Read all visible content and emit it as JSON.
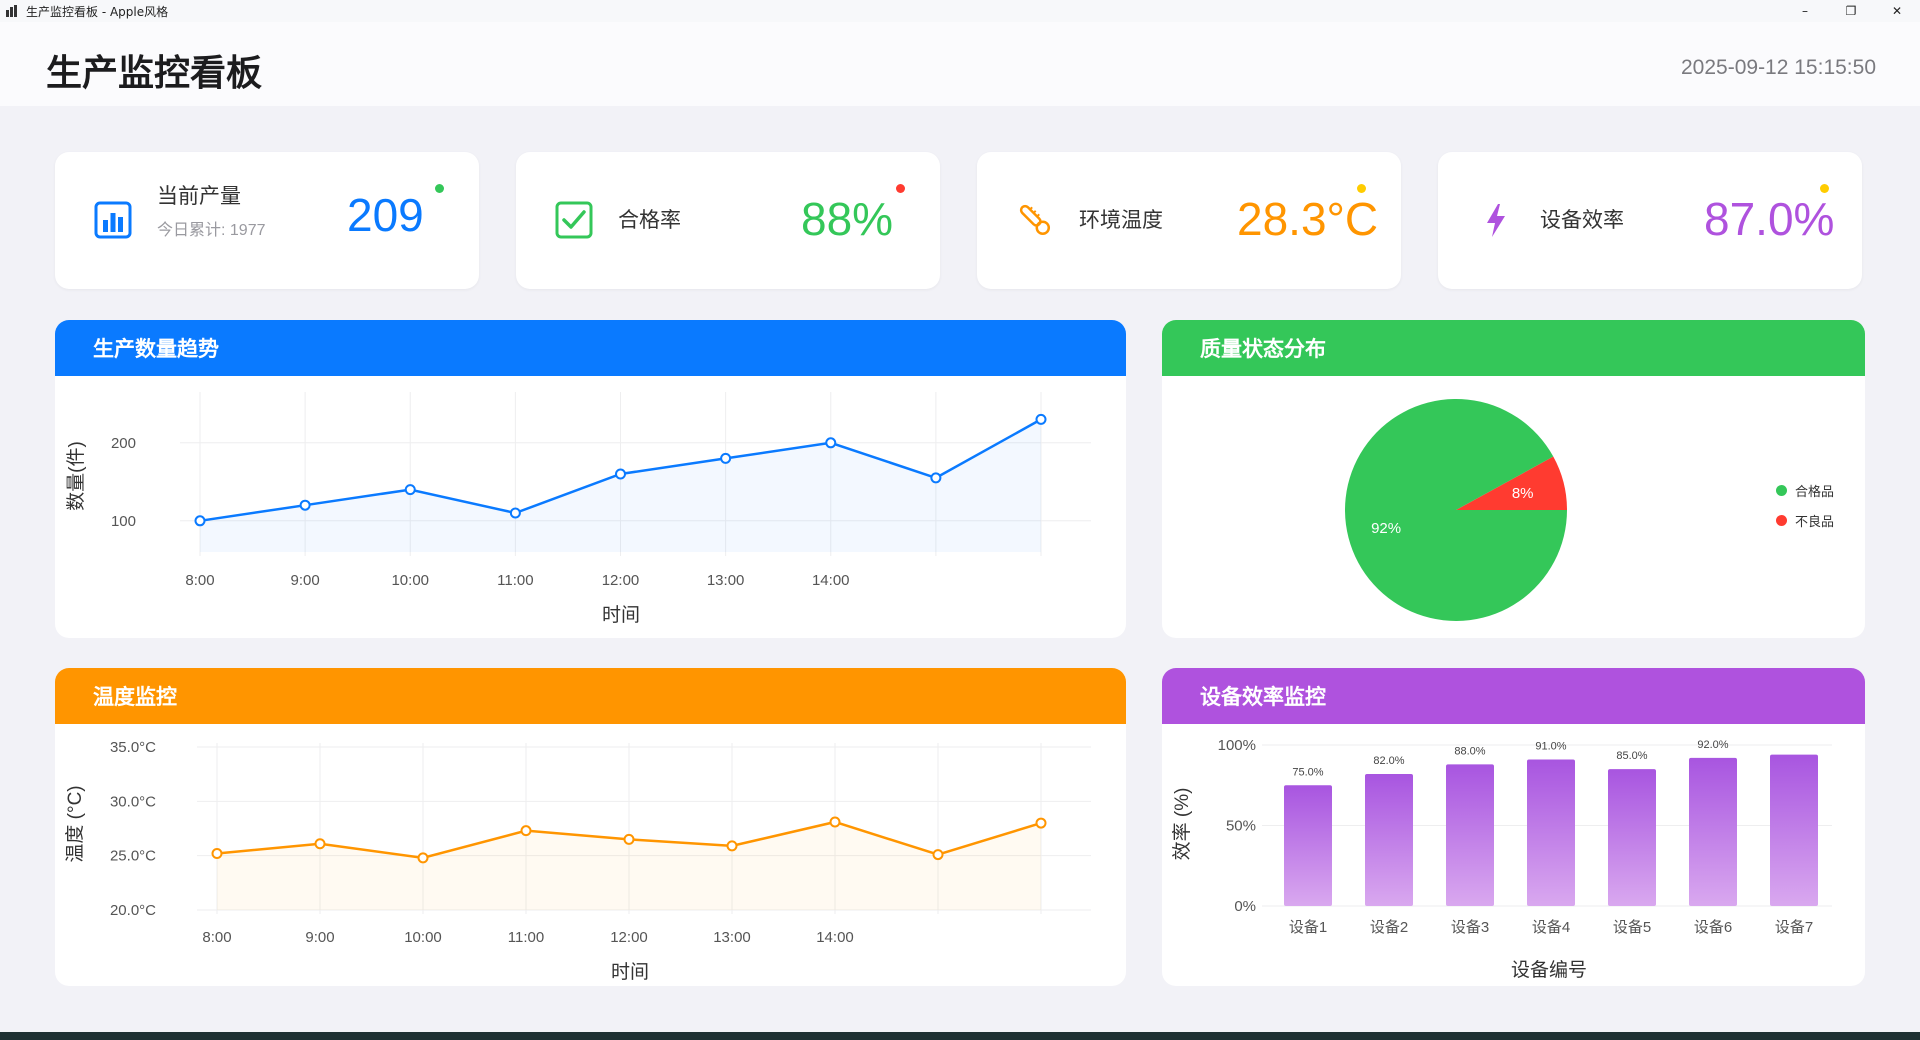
{
  "window": {
    "title": "生产监控看板 - Apple风格",
    "minimize": "–",
    "maximize": "❐",
    "close": "✕"
  },
  "header": {
    "title": "生产监控看板",
    "datetime": "2025-09-12 15:15:50"
  },
  "cards": {
    "production": {
      "label": "当前产量",
      "sub": "今日累计: 1977",
      "value": "209",
      "icon": "bar-chart-icon",
      "color": "#0a7aff",
      "dot": "#34c759"
    },
    "pass_rate": {
      "label": "合格率",
      "value": "88%",
      "icon": "checkbox-icon",
      "color": "#34c759",
      "dot": "#ff3b30"
    },
    "temperature": {
      "label": "环境温度",
      "value": "28.3°C",
      "icon": "thermometer-icon",
      "color": "#ff9500",
      "dot": "#ffcc00"
    },
    "efficiency": {
      "label": "设备效率",
      "value": "87.0%",
      "icon": "lightning-icon",
      "color": "#af52de",
      "dot": "#ffcc00"
    }
  },
  "panels": {
    "production_trend": {
      "title": "生产数量趋势",
      "color": "#0a7aff"
    },
    "quality": {
      "title": "质量状态分布",
      "color": "#34c759"
    },
    "temperature": {
      "title": "温度监控",
      "color": "#ff9500"
    },
    "efficiency": {
      "title": "设备效率监控",
      "color": "#af52de"
    }
  },
  "chart_data": [
    {
      "type": "line",
      "title": "生产数量趋势",
      "xlabel": "时间",
      "ylabel": "数量(件)",
      "x_tick_labels": [
        "8:00",
        "9:00",
        "10:00",
        "11:00",
        "12:00",
        "13:00",
        "14:00"
      ],
      "y_ticks": [
        100,
        200
      ],
      "ylim": [
        60,
        260
      ],
      "values": [
        100,
        120,
        140,
        110,
        160,
        180,
        200,
        155,
        230
      ],
      "color": "#0a7aff",
      "grid": true
    },
    {
      "type": "pie",
      "title": "质量状态分布",
      "slices": [
        {
          "label": "合格品",
          "value": 92,
          "text": "92%",
          "color": "#34c759"
        },
        {
          "label": "不良品",
          "value": 8,
          "text": "8%",
          "color": "#ff3b30"
        }
      ],
      "legend": "right"
    },
    {
      "type": "line",
      "title": "温度监控",
      "xlabel": "时间",
      "ylabel": "温度 (°C)",
      "x_tick_labels": [
        "8:00",
        "9:00",
        "10:00",
        "11:00",
        "12:00",
        "13:00",
        "14:00"
      ],
      "y_tick_labels": [
        "35.0°C",
        "30.0°C",
        "25.0°C",
        "20.0°C"
      ],
      "y_ticks": [
        35,
        30,
        25,
        20
      ],
      "ylim": [
        20,
        35
      ],
      "values": [
        25.2,
        26.1,
        24.8,
        27.3,
        26.5,
        25.9,
        28.1,
        25.1,
        28.0
      ],
      "color": "#ff9500",
      "grid": true
    },
    {
      "type": "bar",
      "title": "设备效率监控",
      "xlabel": "设备编号",
      "ylabel": "效率 (%)",
      "categories": [
        "设备1",
        "设备2",
        "设备3",
        "设备4",
        "设备5",
        "设备6",
        "设备7"
      ],
      "values": [
        75.0,
        82.0,
        88.0,
        91.0,
        85.0,
        92.0,
        94.0
      ],
      "value_labels": [
        "75.0%",
        "82.0%",
        "88.0%",
        "91.0%",
        "85.0%",
        "92.0%",
        ""
      ],
      "y_tick_labels": [
        "100%",
        "50%",
        "0%"
      ],
      "y_ticks": [
        100,
        50,
        0
      ],
      "ylim": [
        0,
        100
      ],
      "color": "#af52de"
    }
  ]
}
